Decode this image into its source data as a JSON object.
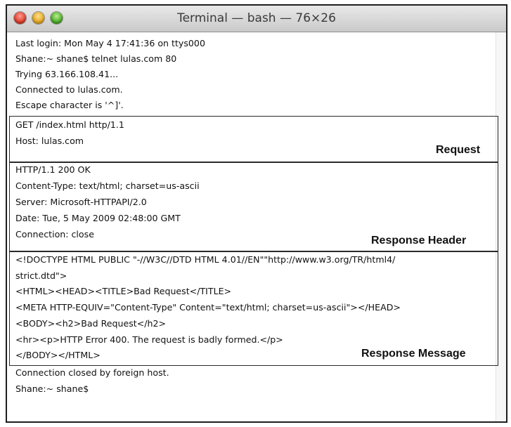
{
  "window": {
    "title": "Terminal — bash — 76×26"
  },
  "terminal": {
    "login_lines": [
      "Last login: Mon May 4 17:41:36 on ttys000",
      "Shane:~ shane$ telnet lulas.com 80",
      "Trying 63.166.108.41...",
      "Connected to lulas.com.",
      "Escape character is '^]'."
    ],
    "request_lines": [
      "GET /index.html http/1.1",
      "Host: lulas.com"
    ],
    "response_header_lines": [
      "HTTP/1.1 200 OK",
      "Content-Type: text/html; charset=us-ascii",
      "Server: Microsoft-HTTPAPI/2.0",
      "Date: Tue, 5 May 2009 02:48:00 GMT",
      "Connection: close"
    ],
    "response_message_lines": [
      "<!DOCTYPE HTML PUBLIC \"-//W3C//DTD HTML 4.01//EN\"\"http://www.w3.org/TR/html4/",
      "strict.dtd\">",
      "<HTML><HEAD><TITLE>Bad Request</TITLE>",
      "<META HTTP-EQUIV=\"Content-Type\" Content=\"text/html; charset=us-ascii\"></HEAD>",
      "<BODY><h2>Bad Request</h2>",
      "<hr><p>HTTP Error 400. The request is badly formed.</p>",
      "</BODY></HTML>"
    ],
    "closing_lines": [
      "Connection closed by foreign host.",
      "Shane:~ shane$"
    ]
  },
  "annotations": {
    "request": "Request",
    "response_header": "Response Header",
    "response_message": "Response Message"
  },
  "colors": {
    "close": "#e0443a",
    "minimize": "#e6a51f",
    "zoom": "#4cb12c"
  }
}
